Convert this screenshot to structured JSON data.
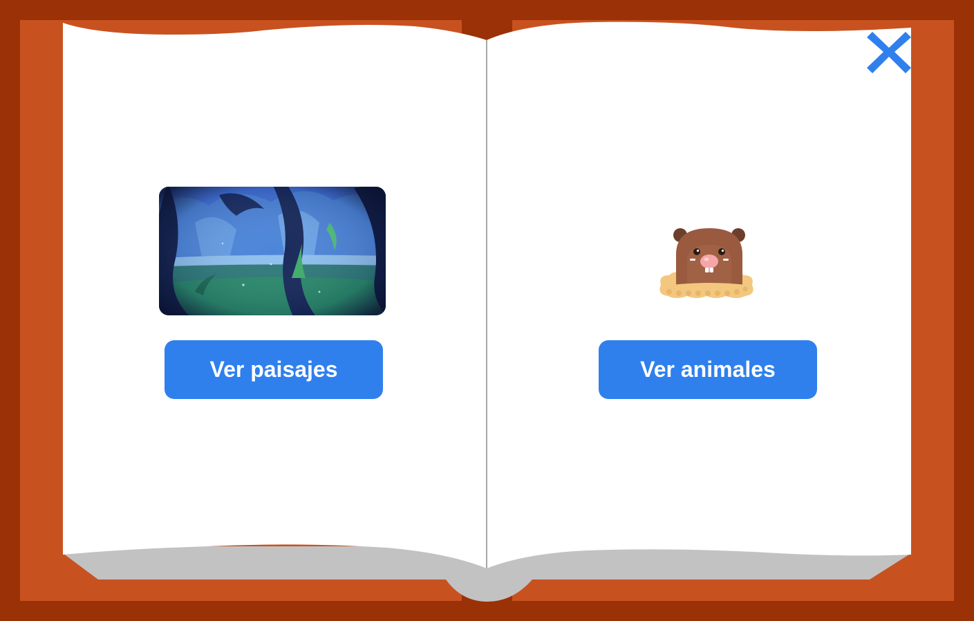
{
  "book": {
    "colors": {
      "frame_outer": "#9b3106",
      "cover": "#c8521f",
      "page": "#ffffff",
      "page_shadow": "#c2c2c2",
      "spine_line": "#8a8a8a"
    }
  },
  "left_page": {
    "illustration_icon": "night-forest-landscape",
    "button_label": "Ver paisajes"
  },
  "right_page": {
    "illustration_icon": "mole-in-hole",
    "button_label": "Ver animales"
  },
  "close": {
    "icon": "close-x-icon",
    "color": "#2f80ed"
  },
  "accent_color": "#2f80ed"
}
